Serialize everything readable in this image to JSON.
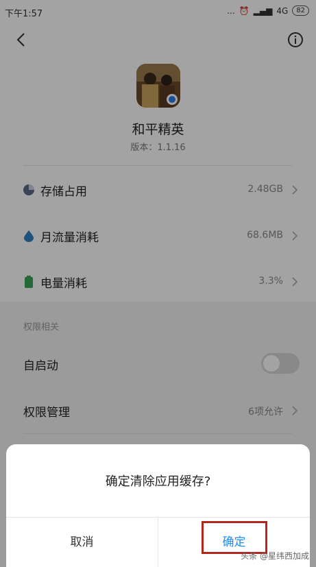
{
  "status_bar": {
    "time": "下午1:57",
    "dots": "...",
    "network": "4G",
    "battery": "82"
  },
  "header": {
    "back_icon": "chevron-left-icon",
    "info_icon": "info-circle-icon"
  },
  "app": {
    "name": "和平精英",
    "version": "版本：1.1.16"
  },
  "usage": [
    {
      "label": "存储占用",
      "value": "2.48GB",
      "icon": "pie-chart-icon",
      "color": "#5a6b8c"
    },
    {
      "label": "月流量消耗",
      "value": "68.6MB",
      "icon": "water-drop-icon",
      "color": "#2f83c6"
    },
    {
      "label": "电量消耗",
      "value": "3.3%",
      "icon": "battery-icon",
      "color": "#3aa55a"
    }
  ],
  "permissions": {
    "section_title": "权限相关",
    "autostart_label": "自启动",
    "autostart_on": false,
    "manage_label": "权限管理",
    "manage_value": "6项允许"
  },
  "dialog": {
    "title": "确定清除应用缓存?",
    "cancel": "取消",
    "confirm": "确定"
  },
  "watermark": "头条 @星纬西加成"
}
